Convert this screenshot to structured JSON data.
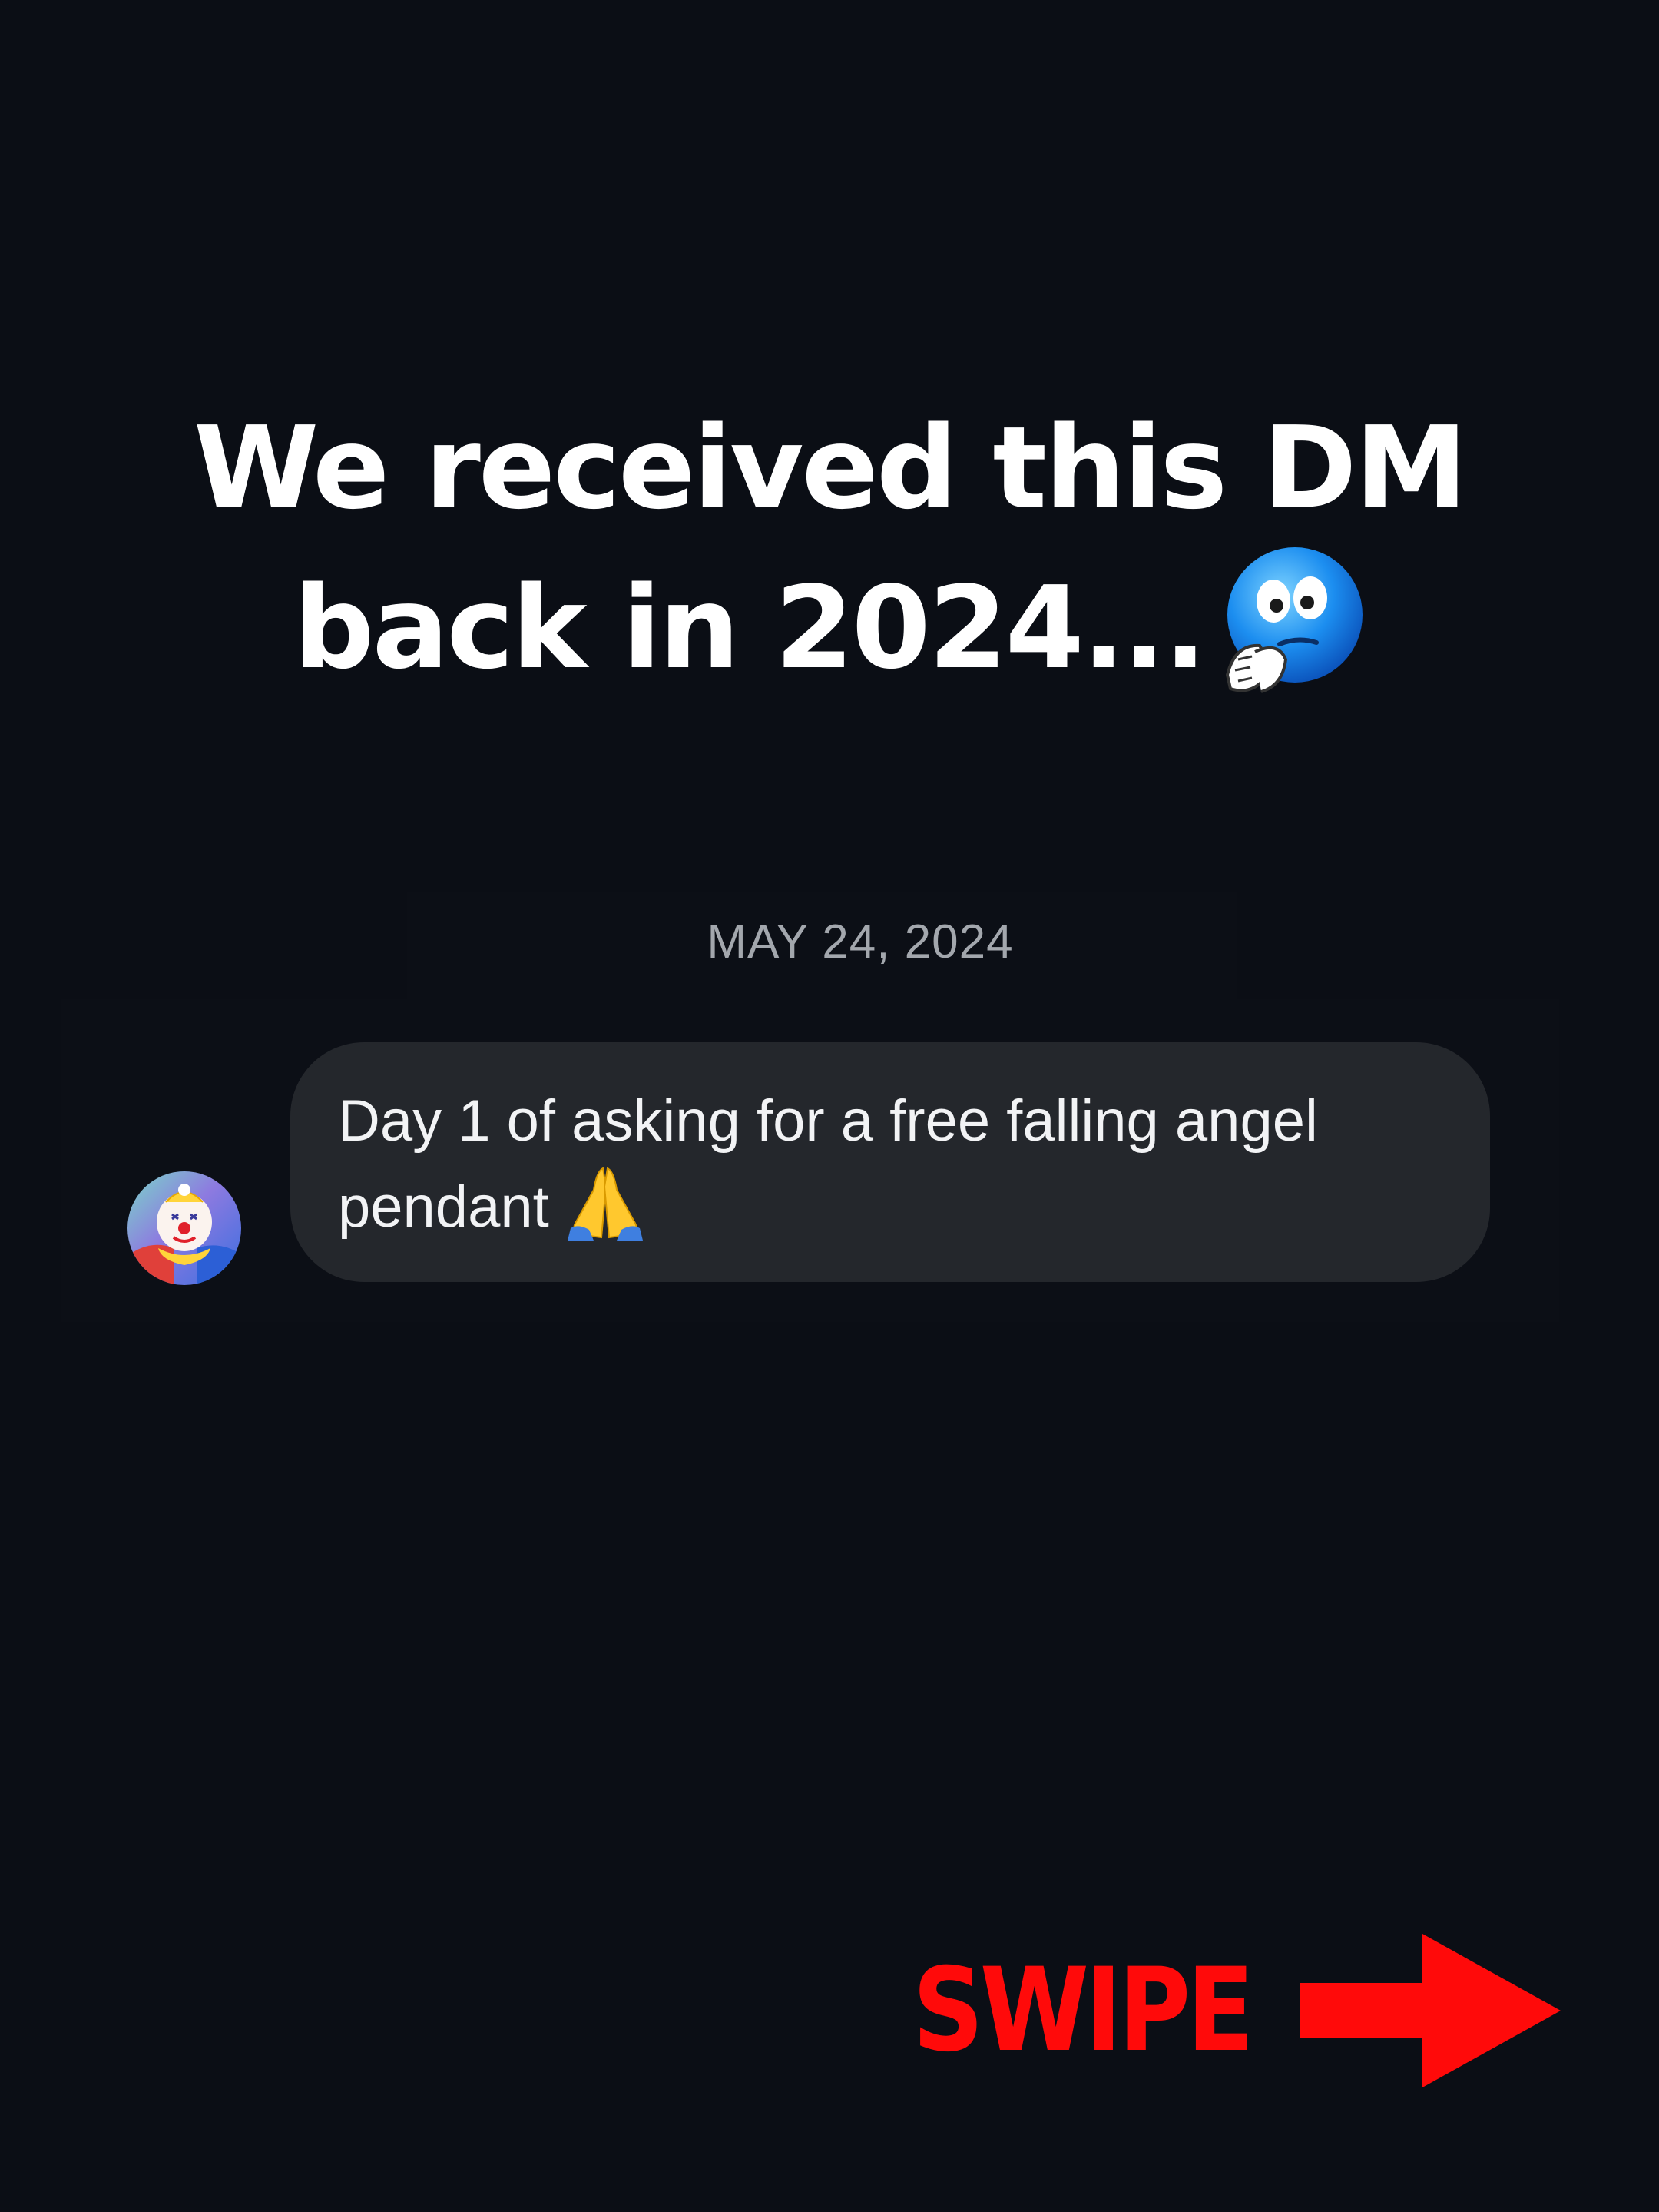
{
  "headline": {
    "line1": "We received this DM",
    "line2": "back in 2024...",
    "emoji_icon": "nervous-praying-face-emoji"
  },
  "conversation": {
    "date": "MAY 24, 2024",
    "message": {
      "line1": "Day 1 of asking for a free falling angel",
      "line2": "pendant",
      "emoji_icon": "folded-hands-emoji",
      "avatar_icon": "clown-avatar"
    }
  },
  "swipe": {
    "label": "SWIPE",
    "icon": "arrow-right-icon",
    "color": "#ff0a0a"
  },
  "colors": {
    "background": "#0b0e15",
    "bubble": "#24272c",
    "date_text": "#a3a7ad"
  }
}
